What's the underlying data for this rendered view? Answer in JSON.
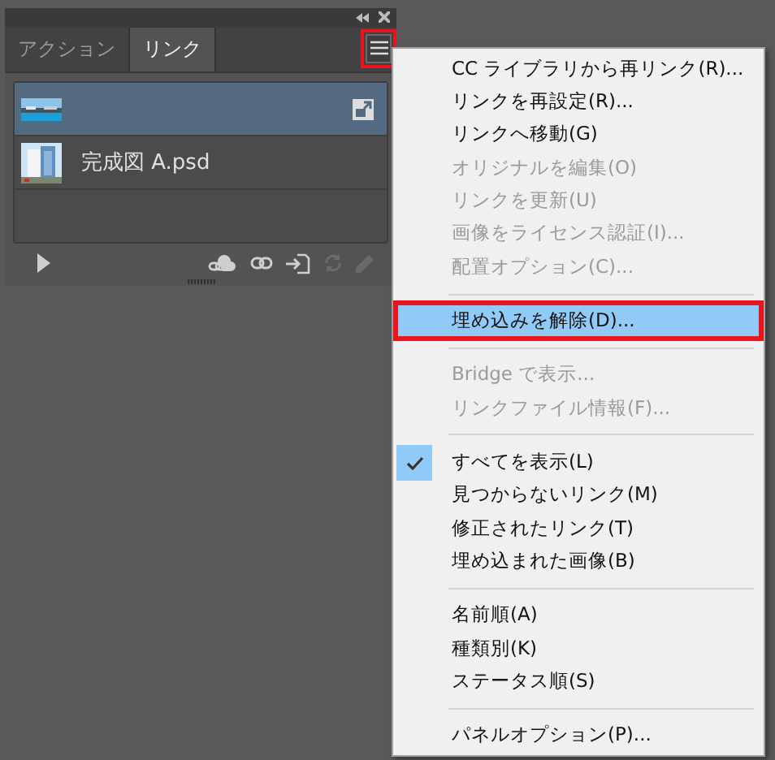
{
  "panel": {
    "tabs": [
      {
        "label": "アクション",
        "selected": false
      },
      {
        "label": "リンク",
        "selected": true
      }
    ],
    "menu_button": {
      "annotated": true
    },
    "links": [
      {
        "kind": "sea",
        "selected": true,
        "embedded": true
      },
      {
        "kind": "building",
        "selected": false,
        "name": "完成図 A.psd"
      }
    ],
    "toolbar": [
      {
        "kind": "play",
        "disabled": false
      },
      {
        "kind": "cloud-link",
        "disabled": false
      },
      {
        "kind": "link",
        "disabled": false
      },
      {
        "kind": "goto",
        "disabled": false
      },
      {
        "kind": "update",
        "disabled": true
      },
      {
        "kind": "edit",
        "disabled": true
      }
    ]
  },
  "menu": {
    "sections": [
      {
        "items": [
          {
            "label": "CC ライブラリから再リンク(R)...",
            "disabled": false,
            "checked": false,
            "selected": false,
            "annotated": false
          },
          {
            "label": "リンクを再設定(R)...",
            "disabled": false,
            "checked": false,
            "selected": false,
            "annotated": false
          },
          {
            "label": "リンクへ移動(G)",
            "disabled": false,
            "checked": false,
            "selected": false,
            "annotated": false
          },
          {
            "label": "オリジナルを編集(O)",
            "disabled": true,
            "checked": false,
            "selected": false,
            "annotated": false
          },
          {
            "label": "リンクを更新(U)",
            "disabled": true,
            "checked": false,
            "selected": false,
            "annotated": false
          },
          {
            "label": "画像をライセンス認証(I)...",
            "disabled": true,
            "checked": false,
            "selected": false,
            "annotated": false
          },
          {
            "label": "配置オプション(C)...",
            "disabled": true,
            "checked": false,
            "selected": false,
            "annotated": false
          }
        ]
      },
      {
        "items": [
          {
            "label": "埋め込みを解除(D)...",
            "disabled": false,
            "checked": false,
            "selected": true,
            "annotated": true
          }
        ]
      },
      {
        "items": [
          {
            "label": "Bridge で表示...",
            "disabled": true,
            "checked": false,
            "selected": false,
            "annotated": false
          },
          {
            "label": "リンクファイル情報(F)...",
            "disabled": true,
            "checked": false,
            "selected": false,
            "annotated": false
          }
        ]
      },
      {
        "items": [
          {
            "label": "すべてを表示(L)",
            "disabled": false,
            "checked": true,
            "selected": false,
            "annotated": false
          },
          {
            "label": "見つからないリンク(M)",
            "disabled": false,
            "checked": false,
            "selected": false,
            "annotated": false
          },
          {
            "label": "修正されたリンク(T)",
            "disabled": false,
            "checked": false,
            "selected": false,
            "annotated": false
          },
          {
            "label": "埋め込まれた画像(B)",
            "disabled": false,
            "checked": false,
            "selected": false,
            "annotated": false
          }
        ]
      },
      {
        "items": [
          {
            "label": "名前順(A)",
            "disabled": false,
            "checked": false,
            "selected": false,
            "annotated": false
          },
          {
            "label": "種類別(K)",
            "disabled": false,
            "checked": false,
            "selected": false,
            "annotated": false
          },
          {
            "label": "ステータス順(S)",
            "disabled": false,
            "checked": false,
            "selected": false,
            "annotated": false
          }
        ]
      },
      {
        "items": [
          {
            "label": "パネルオプション(P)...",
            "disabled": false,
            "checked": false,
            "selected": false,
            "annotated": false
          }
        ]
      }
    ]
  }
}
